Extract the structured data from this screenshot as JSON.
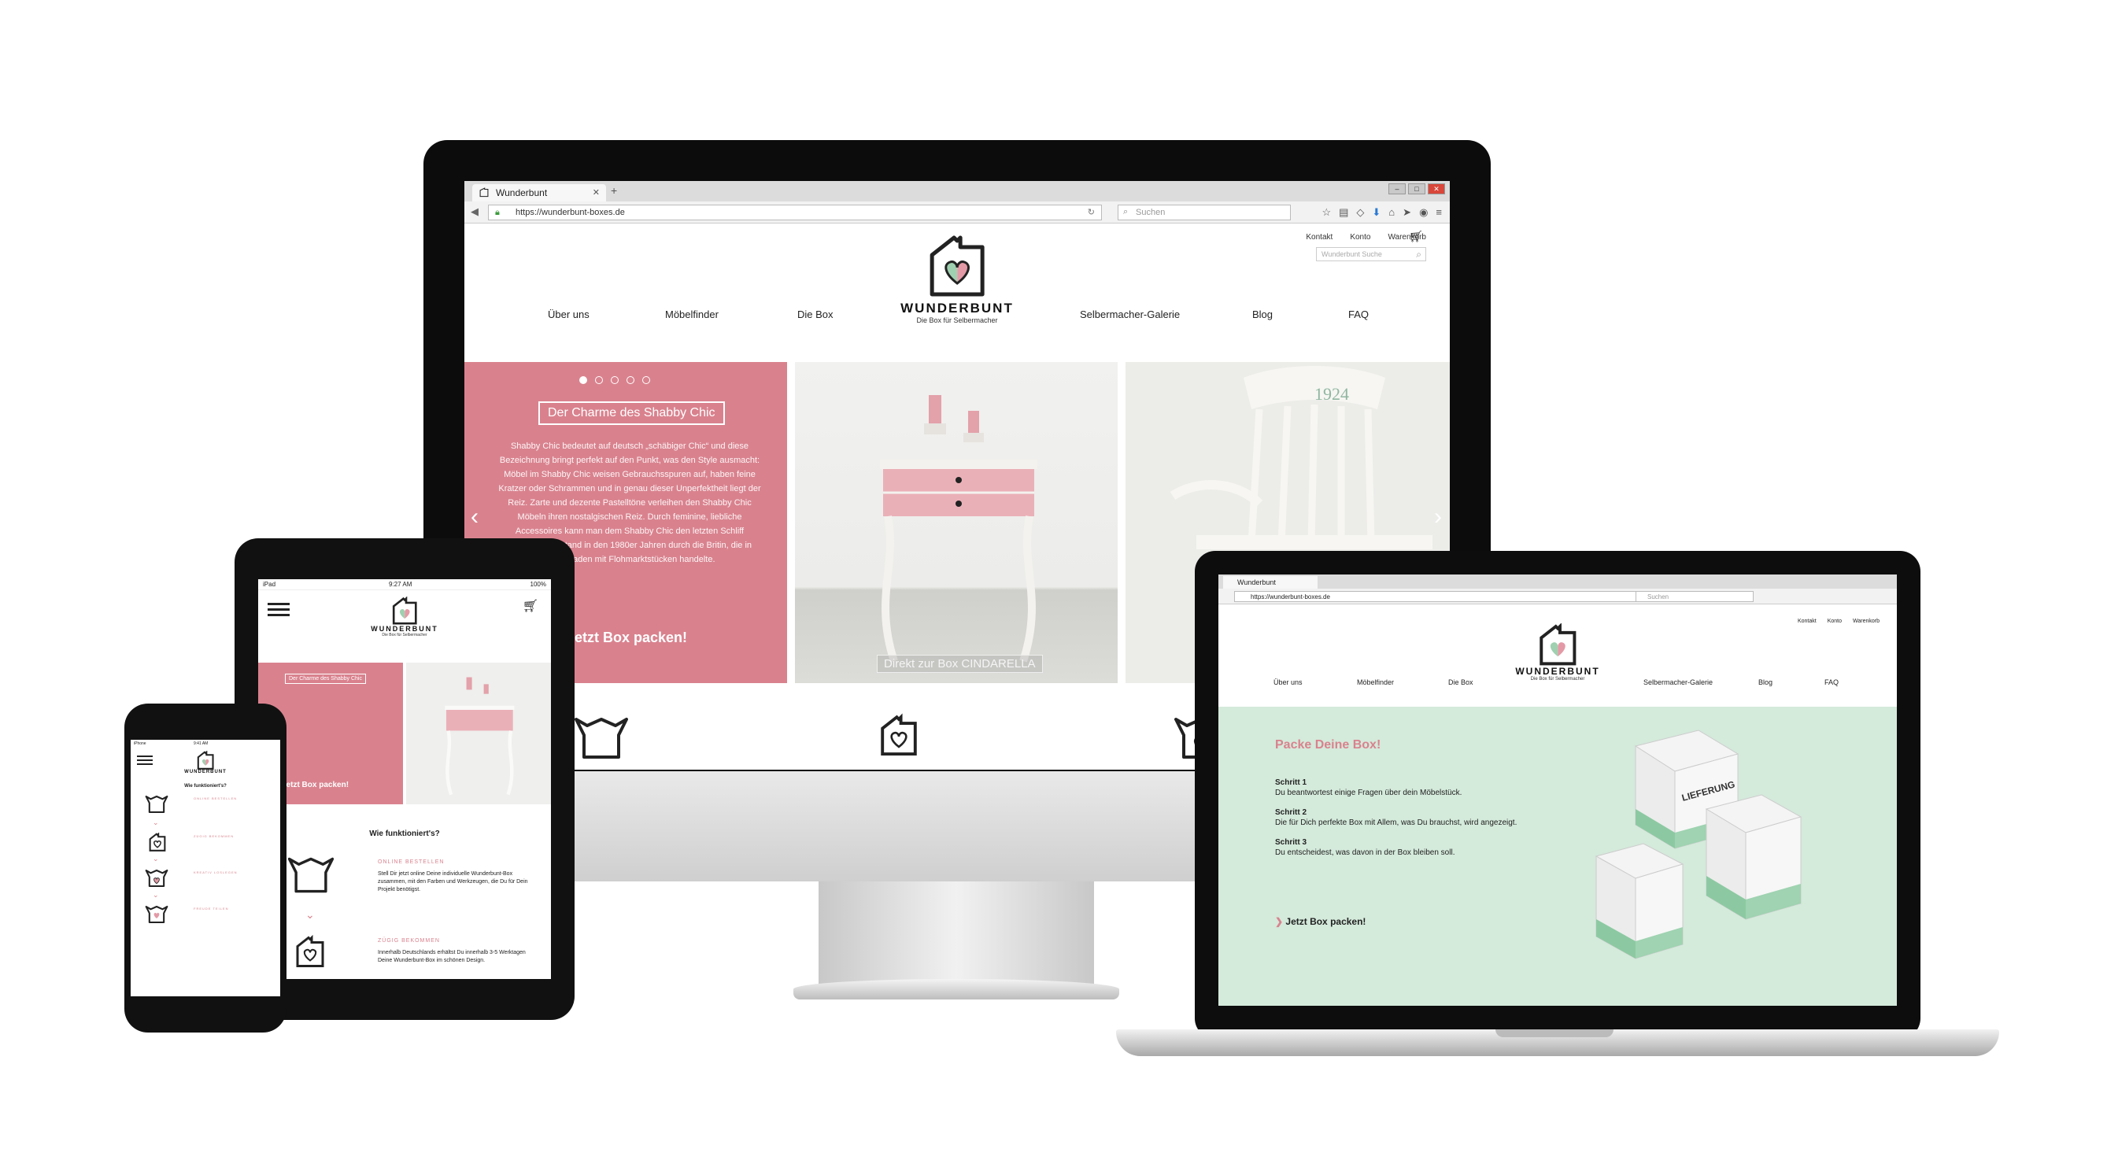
{
  "brand": {
    "name": "WUNDERBUNT",
    "tagline": "Die Box für Selbermacher",
    "pink": "#d9828e",
    "mint": "#d4eadb",
    "logo_icon": "box-heart-icon"
  },
  "browser": {
    "tab_title": "Wunderbunt",
    "url": "https://wunderbunt-boxes.de",
    "search_placeholder": "Suchen"
  },
  "site": {
    "top_links": [
      "Kontakt",
      "Konto",
      "Warenkorb"
    ],
    "search_placeholder": "Wunderbunt Suche",
    "nav": [
      "Über uns",
      "Möbelfinder",
      "Die Box",
      "Selbermacher-Galerie",
      "Blog",
      "FAQ"
    ]
  },
  "slider": {
    "title": "Der Charme des Shabby Chic",
    "body": "Shabby Chic bedeutet auf deutsch „schäbiger Chic“ und diese Bezeichnung bringt perfekt auf den Punkt, was den Style ausmacht: Möbel im Shabby Chic weisen Gebrauchsspuren auf, haben feine Kratzer oder Schrammen und in genau dieser Unperfektheit liegt der Reiz. Zarte und dezente Pastelltöne verleihen den Shabby Chic Möbeln ihren nostalgischen Reiz. Durch feminine, liebliche Accessoires kann man dem Shabby Chic den letzten Schliff verleihen. Entstand in den 1980er Jahren durch die Britin, die in ihrem Laden mit Flohmarktstücken handelte.",
    "cta": "Jetzt Box packen!",
    "photo_caption": "Direkt zur Box CINDARELLA",
    "chair_number": "1924"
  },
  "laptop": {
    "heading": "Packe Deine Box!",
    "steps": [
      {
        "title": "Schritt 1",
        "text": "Du beantwortest einige Fragen über dein Möbelstück."
      },
      {
        "title": "Schritt 2",
        "text": "Die für Dich perfekte Box mit Allem, was Du brauchst, wird angezeigt."
      },
      {
        "title": "Schritt 3",
        "text": "Du entscheidest, was davon in der Box bleiben soll."
      }
    ],
    "cta": "Jetzt Box packen!",
    "box_label": "LIEFERUNG"
  },
  "ipad": {
    "status_left": "iPad",
    "status_time": "9:27 AM",
    "status_right": "100%",
    "slide_title": "Der Charme des Shabby Chic",
    "cta": "Jetzt Box packen!",
    "how_heading": "Wie funktioniert's?",
    "step1_title": "ONLINE BESTELLEN",
    "step1_text": "Stell Dir jetzt online Deine individuelle Wunderbunt-Box zusammen, mit den Farben und Werkzeugen, die Du für Dein Projekt benötigst.",
    "step2_title": "ZÜGIG BEKOMMEN",
    "step2_text": "Innerhalb Deutschlands erhältst Du innerhalb 3-5 Werktagen Deine Wunderbunt-Box im schönen Design."
  },
  "iphone": {
    "status_left": "iPhone",
    "status_time": "9:41 AM",
    "how_heading": "Wie funktioniert's?",
    "steps": [
      "ONLINE BESTELLEN",
      "ZÜGIG BEKOMMEN",
      "KREATIV LOSLEGEN",
      "FREUDE TEILEN"
    ]
  }
}
